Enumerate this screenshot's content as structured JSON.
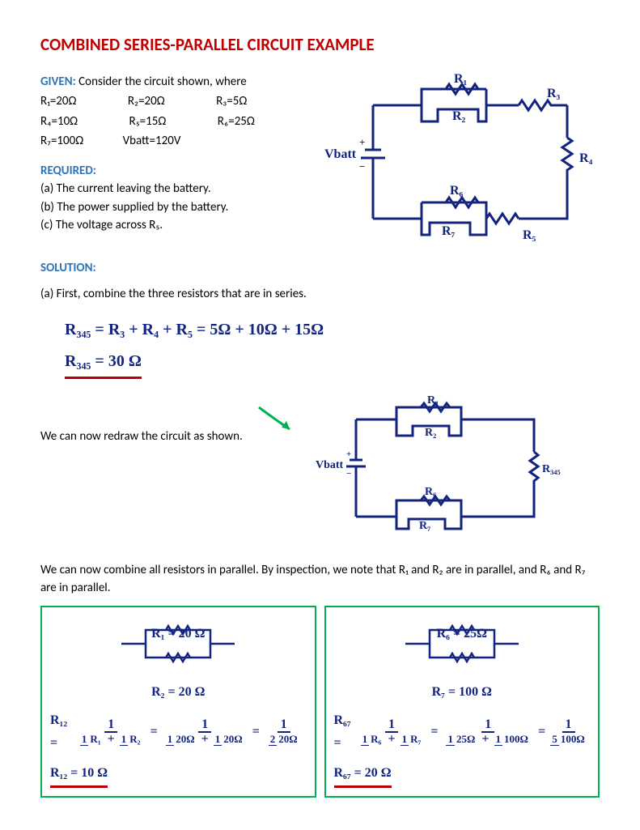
{
  "title": "COMBINED SERIES-PARALLEL CIRCUIT EXAMPLE",
  "given": {
    "label": "GIVEN:",
    "intro": " Consider the circuit shown, where",
    "row1": {
      "a": "R₁=20Ω",
      "b": "R₂=20Ω",
      "c": "R₃=5Ω"
    },
    "row2": {
      "a": "R₄=10Ω",
      "b": "R₅=15Ω",
      "c": "R₆=25Ω"
    },
    "row3": {
      "a": "R₇=100Ω",
      "b": "Vbatt=120V"
    }
  },
  "required": {
    "label": "REQUIRED:",
    "a": "(a) The current leaving the battery.",
    "b": "(b) The power supplied by the battery.",
    "c": "(c) The voltage across R₅."
  },
  "solution": {
    "label": "SOLUTION:",
    "a_intro": "(a) First, combine the three resistors that are in series.",
    "eq1": "R₃₄₅  =  R₃ + R₄ + R₅  =  5Ω + 10Ω + 15Ω",
    "eq2": "R₃₄₅ =  30 Ω",
    "redraw": "We can now redraw the circuit as shown.",
    "parallel_intro": "We can now combine all resistors in parallel. By inspection, we note that R₁ and R₂ are in parallel, and R₆ and R₇ are in parallel.",
    "box1": {
      "r1": "R₁ = 20 Ω",
      "r2": "R₂ = 20 Ω",
      "result": "R₁₂ =  10 Ω",
      "lhs": "R₁₂ =",
      "d1a": "R₁",
      "d1b": "R₂",
      "d2a": "20Ω",
      "d2b": "20Ω",
      "d3t": "2",
      "d3b": "20Ω"
    },
    "box2": {
      "r1": "R₆ = 25Ω",
      "r2": "R₇ = 100 Ω",
      "result": "R₆₇ = 20 Ω",
      "lhs": "R₆₇ =",
      "d1a": "R₆",
      "d1b": "R₇",
      "d2a": "25Ω",
      "d2b": "100Ω",
      "d3t": "5",
      "d3b": "100Ω"
    }
  },
  "circuit1": {
    "vbatt": "Vbatt",
    "r1": "R₁",
    "r2": "R₂",
    "r3": "R₃",
    "r4": "R₄",
    "r5": "R₅",
    "r6": "R₆",
    "r7": "R₇"
  },
  "circuit2": {
    "vbatt": "Vbatt",
    "r1": "R₁",
    "r2": "R₂",
    "r345": "R₃₄₅",
    "r6": "R₆",
    "r7": "R₇"
  }
}
